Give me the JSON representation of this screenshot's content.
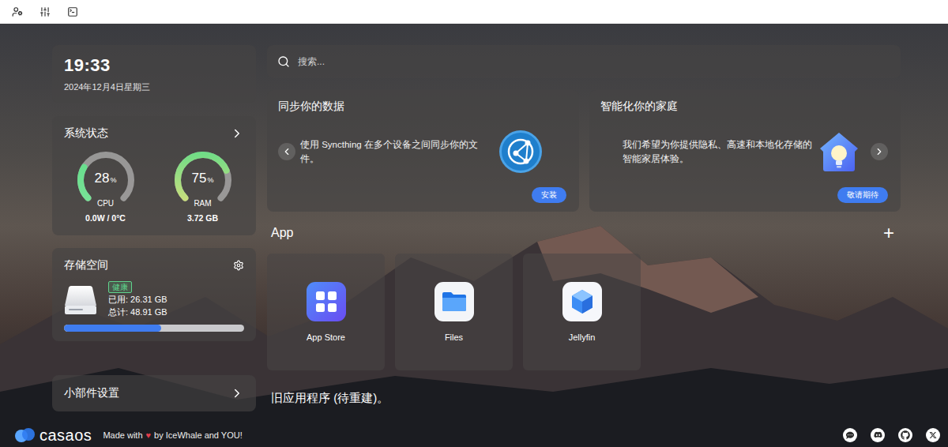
{
  "clock": {
    "time": "19:33",
    "date": "2024年12月4日星期三"
  },
  "system_status": {
    "title": "系统状态",
    "gauges": [
      {
        "name": "CPU",
        "value": "28",
        "unit": "%",
        "level": 0.28,
        "reading": "0.0W / 0°C",
        "color": "#7fe39a"
      },
      {
        "name": "RAM",
        "value": "75",
        "unit": "%",
        "level": 0.75,
        "reading": "3.72 GB",
        "color": "#e6df7a"
      }
    ]
  },
  "storage": {
    "title": "存储空间",
    "badge": "健康",
    "used": "已用: 26.31 GB",
    "total": "总计: 48.91 GB",
    "level": 0.54
  },
  "widget_settings": {
    "label": "小部件设置"
  },
  "search": {
    "placeholder": "搜索..."
  },
  "promo_cards": [
    {
      "title": "同步你的数据",
      "text": "使用 Syncthing 在多个设备之间同步你的文件。",
      "button": "安装",
      "kind": "syncthing",
      "nav": "prev"
    },
    {
      "title": "智能化你的家庭",
      "text": "我们希望为你提供隐私、高速和本地化存储的智能家居体验。",
      "button": "敬请期待",
      "kind": "smart-home",
      "nav": "next"
    }
  ],
  "apps": {
    "title": "App",
    "add": "+",
    "items": [
      {
        "name": "App Store",
        "kind": "appstore"
      },
      {
        "name": "Files",
        "kind": "files"
      },
      {
        "name": "Jellyfin",
        "kind": "jellyfin"
      }
    ]
  },
  "legacy": "旧应用程序 (待重建)。",
  "footer": {
    "logo": "casaos",
    "made_with": "Made with",
    "heart": "♥",
    "credit": "by IceWhale and YOU!"
  }
}
